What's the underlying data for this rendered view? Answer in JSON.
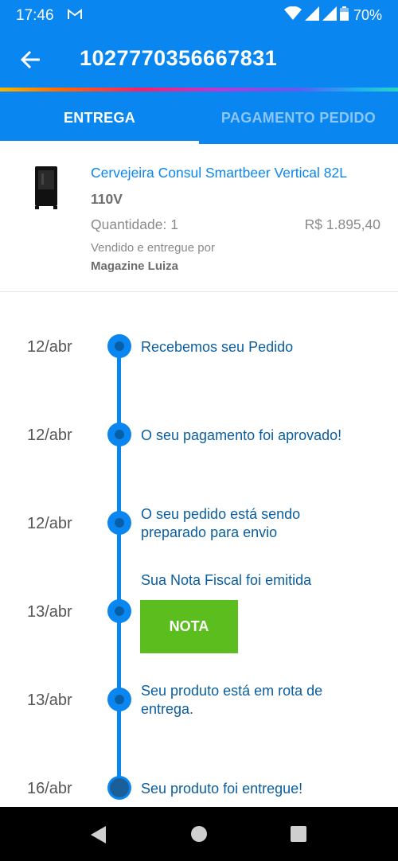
{
  "status_bar": {
    "time": "17:46",
    "battery": "70%",
    "icons": [
      "gmail-icon",
      "wifi-icon",
      "signal-icon",
      "signal-icon",
      "battery-icon"
    ]
  },
  "app_bar": {
    "title": "1027770356667831"
  },
  "tabs": [
    {
      "label": "ENTREGA",
      "active": true
    },
    {
      "label": "PAGAMENTO PEDIDO",
      "active": false
    }
  ],
  "product": {
    "name": "Cervejeira Consul Smartbeer Vertical 82L",
    "voltage": "110V",
    "quantity": "Quantidade: 1",
    "price": "R$ 1.895,40",
    "sold_by_label": "Vendido e entregue por",
    "seller": "Magazine Luiza"
  },
  "timeline": [
    {
      "date": "12/abr",
      "text": "Recebemos seu Pedido"
    },
    {
      "date": "12/abr",
      "text": "O seu pagamento foi aprovado!"
    },
    {
      "date": "12/abr",
      "text_line1": "O seu pedido está sendo",
      "text_line2": "preparado para envio"
    },
    {
      "date": "13/abr",
      "text": "Sua Nota Fiscal foi emitida",
      "button": "NOTA"
    },
    {
      "date": "13/abr",
      "text_line1": "Seu produto está em rota de",
      "text_line2": "entrega."
    },
    {
      "date": "16/abr",
      "text": "Seu produto foi entregue!"
    }
  ],
  "colors": {
    "primary": "#0a86f0",
    "button_green": "#5cbe1e",
    "timeline_text": "#0a5e9e"
  }
}
